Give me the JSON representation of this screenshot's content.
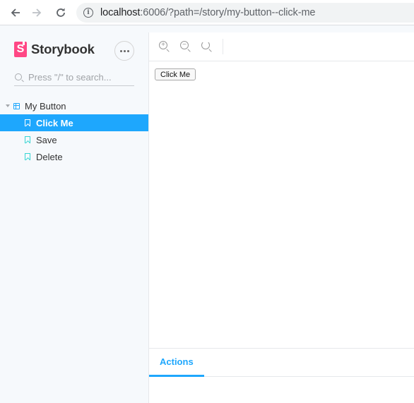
{
  "browser": {
    "url_host": "localhost",
    "url_rest": ":6006/?path=/story/my-button--click-me",
    "back_icon": "arrow-left-icon",
    "forward_icon": "arrow-right-icon",
    "reload_icon": "reload-icon",
    "info_icon": "info-icon",
    "info_glyph": "i"
  },
  "sidebar": {
    "brand": {
      "logo_letter": "S",
      "name": "Storybook"
    },
    "menu_icon": "ellipsis-icon",
    "search": {
      "placeholder": "Press \"/\" to search...",
      "value": ""
    },
    "tree": {
      "component": {
        "label": "My Button",
        "expanded": true
      },
      "stories": [
        {
          "label": "Click Me",
          "selected": true
        },
        {
          "label": "Save",
          "selected": false
        },
        {
          "label": "Delete",
          "selected": false
        }
      ]
    }
  },
  "toolbar": {
    "zoom_in_glyph": "+",
    "zoom_out_glyph": "−",
    "tools": [
      "zoom-in",
      "zoom-out",
      "zoom-reset"
    ]
  },
  "preview": {
    "button_label": "Click Me"
  },
  "panel": {
    "tabs": [
      {
        "label": "Actions",
        "active": true
      }
    ]
  },
  "colors": {
    "accent": "#1ea7fd",
    "brand": "#ff4785",
    "story_icon": "#37d5d3"
  }
}
